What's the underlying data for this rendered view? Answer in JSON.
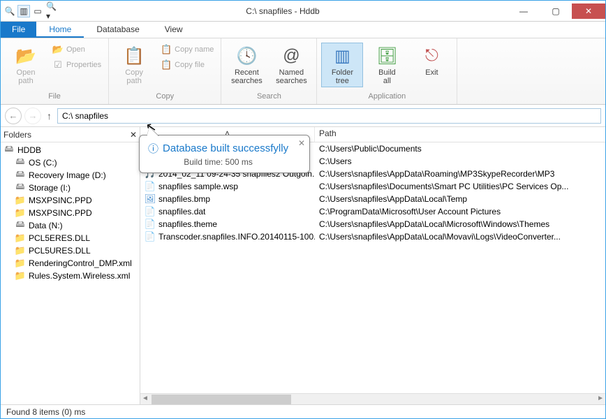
{
  "window": {
    "title": "C:\\ snapfiles - Hddb"
  },
  "tabs": {
    "file": "File",
    "home": "Home",
    "database": "Datatabase",
    "view": "View"
  },
  "ribbon": {
    "file_group": {
      "open_path": "Open\npath",
      "open": "Open",
      "properties": "Properties",
      "label": "File"
    },
    "copy_group": {
      "copy_path": "Copy\npath",
      "copy_name": "Copy name",
      "copy_file": "Copy file",
      "label": "Copy"
    },
    "search_group": {
      "recent": "Recent\nsearches",
      "named": "Named\nsearches",
      "label": "Search"
    },
    "app_group": {
      "folder_tree": "Folder\ntree",
      "build_all": "Build\nall",
      "exit": "Exit",
      "label": "Application"
    }
  },
  "address": "C:\\ snapfiles",
  "folders": {
    "header": "Folders",
    "items": [
      {
        "label": "HDDB",
        "icon": "disk",
        "level": 0
      },
      {
        "label": "OS (C:)",
        "icon": "disk",
        "level": 1
      },
      {
        "label": "Recovery Image (D:)",
        "icon": "disk",
        "level": 1
      },
      {
        "label": "Storage (I:)",
        "icon": "disk",
        "level": 1
      },
      {
        "label": "MSXPSINC.PPD",
        "icon": "folder",
        "level": 1
      },
      {
        "label": "MSXPSINC.PPD",
        "icon": "folder",
        "level": 1
      },
      {
        "label": "Data (N:)",
        "icon": "disk",
        "level": 1
      },
      {
        "label": "PCL5ERES.DLL",
        "icon": "folder",
        "level": 1
      },
      {
        "label": "PCL5URES.DLL",
        "icon": "folder",
        "level": 1
      },
      {
        "label": "RenderingControl_DMP.xml",
        "icon": "folder",
        "level": 1
      },
      {
        "label": "Rules.System.Wireless.xml",
        "icon": "folder",
        "level": 1
      }
    ]
  },
  "list": {
    "header_name": "˄",
    "header_path": "Path",
    "rows": [
      {
        "icon": "folder",
        "name": "",
        "path": "C:\\Users\\Public\\Documents"
      },
      {
        "icon": "folder",
        "name": "",
        "path": "C:\\Users"
      },
      {
        "icon": "audio",
        "name": "2014_02_11 09-24-35 snapfiles2 Outgoin...",
        "path": "C:\\Users\\snapfiles\\AppData\\Roaming\\MP3SkypeRecorder\\MP3"
      },
      {
        "icon": "doc",
        "name": "snapfiles sample.wsp",
        "path": "C:\\Users\\snapfiles\\Documents\\Smart PC Utilities\\PC Services Op..."
      },
      {
        "icon": "img",
        "name": "snapfiles.bmp",
        "path": "C:\\Users\\snapfiles\\AppData\\Local\\Temp"
      },
      {
        "icon": "doc",
        "name": "snapfiles.dat",
        "path": "C:\\ProgramData\\Microsoft\\User Account Pictures"
      },
      {
        "icon": "doc",
        "name": "snapfiles.theme",
        "path": "C:\\Users\\snapfiles\\AppData\\Local\\Microsoft\\Windows\\Themes"
      },
      {
        "icon": "doc",
        "name": "Transcoder.snapfiles.INFO.20140115-100...",
        "path": "C:\\Users\\snapfiles\\AppData\\Local\\Movavi\\Logs\\VideoConverter..."
      }
    ]
  },
  "toast": {
    "title": "Database built successfylly",
    "subtitle": "Build time: 500 ms"
  },
  "status": "Found 8 items (0) ms"
}
